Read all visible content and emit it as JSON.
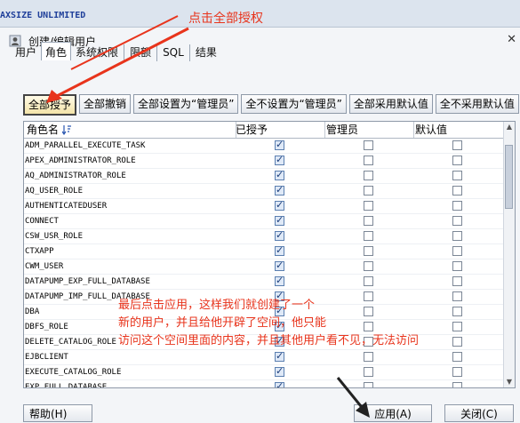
{
  "background": {
    "text": "AXSIZE UNLIMITED"
  },
  "dialog": {
    "title": "创建/编辑用户",
    "close_glyph": "✕"
  },
  "tabs": [
    {
      "label": "用户",
      "active": false
    },
    {
      "label": "角色",
      "active": true
    },
    {
      "label": "系统权限",
      "active": false
    },
    {
      "label": "限额",
      "active": false
    },
    {
      "label": "SQL",
      "active": false
    },
    {
      "label": "结果",
      "active": false
    }
  ],
  "toolbar": {
    "grant_all": "全部授予",
    "revoke_all": "全部撤销",
    "set_all_admin": "全部设置为“管理员”",
    "unset_all_admin": "全不设置为“管理员”",
    "default_all": "全部采用默认值",
    "no_default_all": "全不采用默认值"
  },
  "table": {
    "headers": {
      "role": "角色名",
      "granted": "已授予",
      "admin": "管理员",
      "default": "默认值"
    },
    "sort_icon": "sort-descending-icon",
    "rows": [
      {
        "name": "ADM_PARALLEL_EXECUTE_TASK",
        "granted": true,
        "admin": false,
        "default": false
      },
      {
        "name": "APEX_ADMINISTRATOR_ROLE",
        "granted": true,
        "admin": false,
        "default": false
      },
      {
        "name": "AQ_ADMINISTRATOR_ROLE",
        "granted": true,
        "admin": false,
        "default": false
      },
      {
        "name": "AQ_USER_ROLE",
        "granted": true,
        "admin": false,
        "default": false
      },
      {
        "name": "AUTHENTICATEDUSER",
        "granted": true,
        "admin": false,
        "default": false
      },
      {
        "name": "CONNECT",
        "granted": true,
        "admin": false,
        "default": false
      },
      {
        "name": "CSW_USR_ROLE",
        "granted": true,
        "admin": false,
        "default": false
      },
      {
        "name": "CTXAPP",
        "granted": true,
        "admin": false,
        "default": false
      },
      {
        "name": "CWM_USER",
        "granted": true,
        "admin": false,
        "default": false
      },
      {
        "name": "DATAPUMP_EXP_FULL_DATABASE",
        "granted": true,
        "admin": false,
        "default": false
      },
      {
        "name": "DATAPUMP_IMP_FULL_DATABASE",
        "granted": true,
        "admin": false,
        "default": false
      },
      {
        "name": "DBA",
        "granted": true,
        "admin": false,
        "default": false
      },
      {
        "name": "DBFS_ROLE",
        "granted": true,
        "admin": false,
        "default": false
      },
      {
        "name": "DELETE_CATALOG_ROLE",
        "granted": true,
        "admin": false,
        "default": false
      },
      {
        "name": "EJBCLIENT",
        "granted": true,
        "admin": false,
        "default": false
      },
      {
        "name": "EXECUTE_CATALOG_ROLE",
        "granted": true,
        "admin": false,
        "default": false
      },
      {
        "name": "EXP_FULL_DATABASE",
        "granted": true,
        "admin": false,
        "default": false
      }
    ]
  },
  "bottom": {
    "help": "帮助(H)",
    "apply": "应用(A)",
    "close": "关闭(C)"
  },
  "annotations": {
    "top": "点击全部授权",
    "middle_line1": "最后点击应用，这样我们就创建了一个",
    "middle_line2": "新的用户，并且给他开辟了空间，他只能",
    "middle_line3": "访问这个空间里面的内容，并且其他用户看不见，无法访问",
    "color": "#e8341c"
  }
}
